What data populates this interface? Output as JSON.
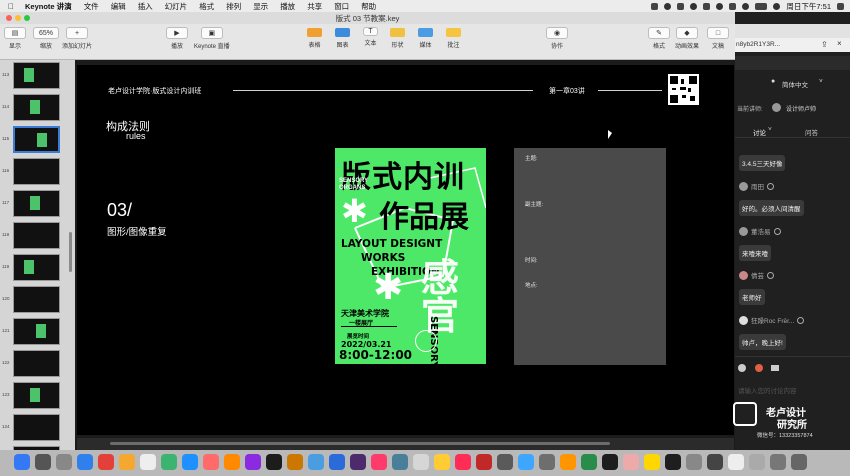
{
  "menubar": {
    "app_name": "Keynote 讲演",
    "items": [
      "文件",
      "编辑",
      "插入",
      "幻灯片",
      "格式",
      "排列",
      "显示",
      "播放",
      "共享",
      "窗口",
      "帮助"
    ],
    "clock": "周日下午7:51"
  },
  "window": {
    "title": "版式 03 节教案.key"
  },
  "toolbar": {
    "view": "显示",
    "zoom_value": "65%",
    "zoom_label": "缩放",
    "add_slide": "添加幻灯片",
    "play": "播放",
    "keynote_live": "Keynote 直播",
    "table": "表格",
    "chart": "图表",
    "text": "文本",
    "shape": "形状",
    "media": "媒体",
    "comment": "批注",
    "collaborate": "协作",
    "format": "格式",
    "animate": "动画效果",
    "document": "文稿"
  },
  "navigator": {
    "numbers": [
      "113",
      "114",
      "115",
      "116",
      "117",
      "118",
      "119",
      "120",
      "121",
      "122",
      "123",
      "124",
      "125"
    ]
  },
  "slide": {
    "header_left": "老卢设计学院·版式设计内训班",
    "header_right": "第一章03讲",
    "rule_title": "构成法则",
    "rule_sub": "rules",
    "section_num": "03/",
    "section_title": "图形/图像重复"
  },
  "poster": {
    "title_line1": "版式内训",
    "title_line2": "作品展",
    "sensory_en": "SENSORY ORGANS",
    "layout_line1": "LAYOUT DESIGNT",
    "layout_line2": "WORKS",
    "layout_line3": "EXHIBITION",
    "big_char": "感官",
    "vertical_en": "SENSORY ORGANS",
    "school": "天津美术学院",
    "venue": "一楼展厅",
    "time_label": "展览时间",
    "date": "2022/03.21",
    "hours": "8:00-12:00"
  },
  "placeholder": {
    "theme": "主题:",
    "subtitle": "副主题:",
    "time": "时间:",
    "place": "地点:"
  },
  "side_panel": {
    "url": "n8yb2R1Y3R...",
    "language": "简体中文",
    "lecturer_label": "当前讲师:",
    "lecturer_name": "设计师卢帅",
    "tab_discuss": "讨论",
    "tab_qa": "问答",
    "messages": [
      {
        "user": "",
        "text": "3.4.5三天好像"
      },
      {
        "user": "雨田",
        "text": "好的。必须人间清醒"
      },
      {
        "user": "董浩易",
        "text": "来噎来噎"
      },
      {
        "user": "倩芸",
        "text": "老师好"
      },
      {
        "user": "狂躁Roc Frēr...",
        "text": "帅卢，晚上好!"
      }
    ],
    "input_placeholder": "请输入您的讨论内容",
    "brand_line1": "老卢设计",
    "brand_line2": "研究所",
    "wechat": "微信号：13323357874"
  },
  "colors": {
    "poster_green": "#4ee868",
    "selection_blue": "#3a7bd5"
  }
}
